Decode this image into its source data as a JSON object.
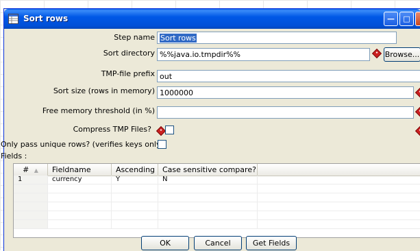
{
  "window": {
    "title": "Sort rows",
    "title_icon": "spreadsheet-icon"
  },
  "form": {
    "step_name": {
      "label": "Step name",
      "value": "Sort rows"
    },
    "sort_directory": {
      "label": "Sort directory",
      "value": "%%java.io.tmpdir%%",
      "browse_label": "Browse..."
    },
    "tmp_prefix": {
      "label": "TMP-file prefix",
      "value": "out"
    },
    "sort_size": {
      "label": "Sort size (rows in memory)",
      "value": "1000000"
    },
    "free_memory": {
      "label": "Free memory threshold (in %)",
      "value": ""
    },
    "compress_tmp": {
      "label": "Compress TMP Files?",
      "checked": false
    },
    "only_unique": {
      "label": "Only pass unique rows? (verifies keys only)",
      "checked": false
    },
    "fields_label": "Fields :"
  },
  "table": {
    "columns": [
      "#",
      "Fieldname",
      "Ascending",
      "Case sensitive compare?"
    ],
    "sort_indicator": "▲",
    "rows": [
      {
        "num": "1",
        "fieldname": "currency",
        "ascending": "Y",
        "case_sensitive": "N"
      }
    ]
  },
  "buttons": {
    "ok": "OK",
    "cancel": "Cancel",
    "get_fields": "Get Fields"
  },
  "colors": {
    "titlebar": "#0058e6",
    "dialog_bg": "#ece9d8",
    "variable_marker": "#cc2020",
    "selection": "#316ac5"
  }
}
